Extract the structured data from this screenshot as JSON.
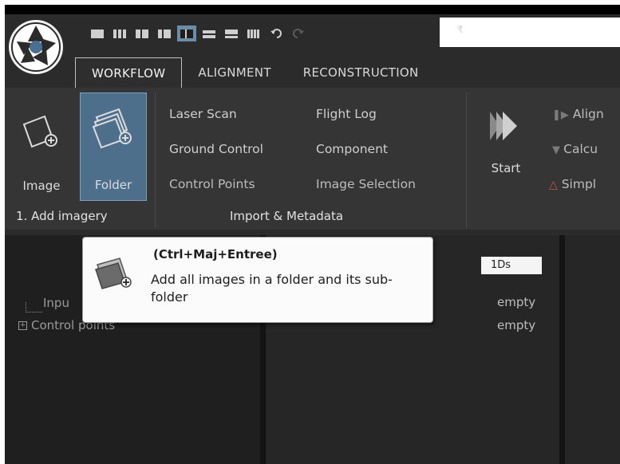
{
  "quick_access": {
    "items": [
      {
        "icon": "layout-1-icon",
        "active": false
      },
      {
        "icon": "layout-2-icon",
        "active": false
      },
      {
        "icon": "layout-3-icon",
        "active": false
      },
      {
        "icon": "layout-4-icon",
        "active": false
      },
      {
        "icon": "layout-5-icon",
        "active": true
      },
      {
        "icon": "layout-6-icon",
        "active": false
      },
      {
        "icon": "layout-7-icon",
        "active": false
      },
      {
        "icon": "layout-8-icon",
        "active": false
      }
    ],
    "dropdown_glyph": "₹"
  },
  "tabs": [
    {
      "label": "WORKFLOW",
      "active": true
    },
    {
      "label": "ALIGNMENT",
      "active": false
    },
    {
      "label": "RECONSTRUCTION",
      "active": false
    }
  ],
  "ribbon": {
    "add_imagery": {
      "image_label": "Image",
      "folder_label": "Folder",
      "group_label": "1. Add imagery"
    },
    "import_metadata": {
      "col1": [
        "Laser Scan",
        "Ground Control",
        "Control Points"
      ],
      "col2": [
        "Flight Log",
        "Component",
        "Image Selection"
      ],
      "group_label": "Import & Metadata"
    },
    "process": {
      "start_label": "Start",
      "items": [
        "Align",
        "Calcu",
        "Simpl"
      ]
    }
  },
  "panels": {
    "tree": {
      "inputs_label": "Inpu",
      "control_points_label": "Control points"
    },
    "ds_label": "1Ds",
    "values": [
      "empty",
      "empty"
    ]
  },
  "tooltip": {
    "shortcut": "(Ctrl+Maj+Entree)",
    "description": "Add all images in a folder and its sub-folder"
  },
  "colors": {
    "background": "#2b2b2b",
    "ribbon": "#353535",
    "selected": "#4d6f8c",
    "tooltip_bg": "#fbfbfb"
  }
}
